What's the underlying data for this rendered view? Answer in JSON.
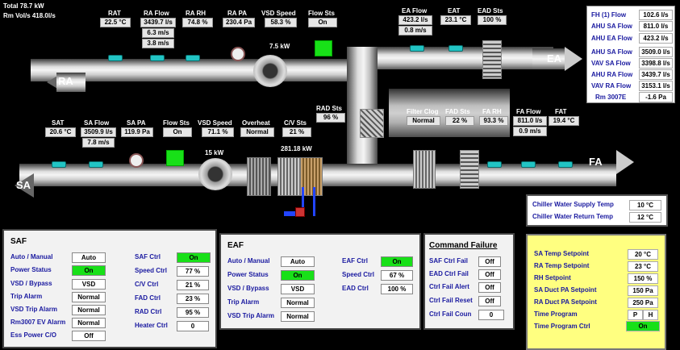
{
  "header": {
    "total": "Total 78.7 kW",
    "rm_vol": "Rm Vol/s 418.0l/s"
  },
  "return_air": {
    "rat": {
      "label": "RAT",
      "value": "22.5 °C"
    },
    "ra_flow": {
      "label": "RA Flow",
      "value": "3439.7 l/s",
      "vel": "6.3 m/s",
      "vel2": "3.8 m/s"
    },
    "ra_rh": {
      "label": "RA RH",
      "value": "74.8 %"
    },
    "ra_pa": {
      "label": "RA PA",
      "value": "230.4 Pa"
    },
    "vsd_speed": {
      "label": "VSD Speed",
      "value": "58.3 %"
    },
    "flow_sts": {
      "label": "Flow Sts",
      "value": "On"
    },
    "fan_kw": "7.5 kW",
    "ea_flow": {
      "label": "EA Flow",
      "value": "423.2 l/s",
      "vel": "0.8 m/s"
    },
    "eat": {
      "label": "EAT",
      "value": "23.1 °C"
    },
    "ead_sts": {
      "label": "EAD Sts",
      "value": "100 %"
    },
    "ra_tag": "RA",
    "ea_tag": "EA"
  },
  "supply_air": {
    "sat": {
      "label": "SAT",
      "value": "20.6 °C"
    },
    "sa_flow": {
      "label": "SA Flow",
      "value": "3509.9 l/s",
      "vel": "7.8 m/s"
    },
    "sa_pa": {
      "label": "SA PA",
      "value": "119.9 Pa"
    },
    "flow_sts": {
      "label": "Flow Sts",
      "value": "On"
    },
    "vsd_speed": {
      "label": "VSD Speed",
      "value": "71.1 %"
    },
    "overheat": {
      "label": "Overheat",
      "value": "Normal"
    },
    "cv_sts": {
      "label": "C/V Sts",
      "value": "21 %"
    },
    "fan_kw": "15 kW",
    "coil_kw": "281.18 kW",
    "rad_sts": {
      "label": "RAD Sts",
      "value": "96 %"
    },
    "filter_clog": {
      "label": "Filter Clog",
      "value": "Normal"
    },
    "fad_sts": {
      "label": "FAD Sts",
      "value": "22 %"
    },
    "fa_rh": {
      "label": "FA RH",
      "value": "93.3 %"
    },
    "fa_flow": {
      "label": "FA Flow",
      "value": "811.0 l/s",
      "vel": "0.9 m/s"
    },
    "fat": {
      "label": "FAT",
      "value": "19.4 °C"
    },
    "sa_tag": "SA",
    "fa_tag": "FA"
  },
  "flow_table": [
    {
      "label": "FH (1) Flow",
      "value": "102.6 l/s"
    },
    {
      "label": "AHU SA Flow",
      "value": "811.0 l/s"
    },
    {
      "label": "AHU EA Flow",
      "value": "423.2 l/s"
    },
    {
      "label": "AHU SA Flow",
      "value": "3509.0 l/s"
    },
    {
      "label": "VAV SA Flow",
      "value": "3398.8 l/s"
    },
    {
      "label": "AHU RA Flow",
      "value": "3439.7 l/s"
    },
    {
      "label": "VAV RA Flow",
      "value": "3153.1 l/s"
    },
    {
      "label": "Rm 3007E",
      "value": "-1.6 Pa"
    }
  ],
  "chiller": {
    "supply_label": "Chiller Water Supply Temp",
    "supply_value": "10 °C",
    "return_label": "Chiller Water Return Temp",
    "return_value": "12 °C"
  },
  "saf": {
    "title": "SAF",
    "left": [
      {
        "label": "Auto / Manual",
        "value": "Auto"
      },
      {
        "label": "Power Status",
        "value": "On"
      },
      {
        "label": "VSD / Bypass",
        "value": "VSD"
      },
      {
        "label": "Trip Alarm",
        "value": "Normal"
      },
      {
        "label": "VSD Trip Alarm",
        "value": "Normal"
      },
      {
        "label": "Rm3007 EV Alarm",
        "value": "Normal"
      },
      {
        "label": "Ess Power C/O",
        "value": "Off"
      }
    ],
    "right": [
      {
        "label": "SAF Ctrl",
        "value": "On"
      },
      {
        "label": "Speed Ctrl",
        "value": "77 %"
      },
      {
        "label": "C/V Ctrl",
        "value": "21 %"
      },
      {
        "label": "FAD Ctrl",
        "value": "23 %"
      },
      {
        "label": "RAD Ctrl",
        "value": "95 %"
      },
      {
        "label": "Heater Ctrl",
        "value": "0"
      }
    ]
  },
  "eaf": {
    "title": "EAF",
    "left": [
      {
        "label": "Auto / Manual",
        "value": "Auto"
      },
      {
        "label": "Power Status",
        "value": "On"
      },
      {
        "label": "VSD / Bypass",
        "value": "VSD"
      },
      {
        "label": "Trip Alarm",
        "value": "Normal"
      },
      {
        "label": "VSD Trip Alarm",
        "value": "Normal"
      }
    ],
    "right": [
      {
        "label": "EAF Ctrl",
        "value": "On"
      },
      {
        "label": "Speed Ctrl",
        "value": "67 %"
      },
      {
        "label": "EAD Ctrl",
        "value": "100 %"
      }
    ]
  },
  "command_failure": {
    "title": "Command Failure",
    "items": [
      {
        "label": "SAF Ctrl Fail",
        "value": "Off"
      },
      {
        "label": "EAD Ctrl Fail",
        "value": "Off"
      },
      {
        "label": "Ctrl Fail Alert",
        "value": "Off"
      },
      {
        "label": "Ctrl Fail Reset",
        "value": "Off"
      },
      {
        "label": "Ctrl Fail Coun",
        "value": "0"
      }
    ]
  },
  "setpoints": {
    "items": [
      {
        "label": "SA Temp Setpoint",
        "value": "20 °C"
      },
      {
        "label": "RA Temp Setpoint",
        "value": "23 °C"
      },
      {
        "label": "RH Setpoint",
        "value": "150 %"
      },
      {
        "label": "SA Duct PA Setpoint",
        "value": "150 Pa"
      },
      {
        "label": "RA Duct PA Setpoint",
        "value": "250 Pa"
      }
    ],
    "time_program_label": "Time Program",
    "time_program_p": "P",
    "time_program_h": "H",
    "time_ctrl_label": "Time Program Ctrl",
    "time_ctrl_value": "On"
  }
}
